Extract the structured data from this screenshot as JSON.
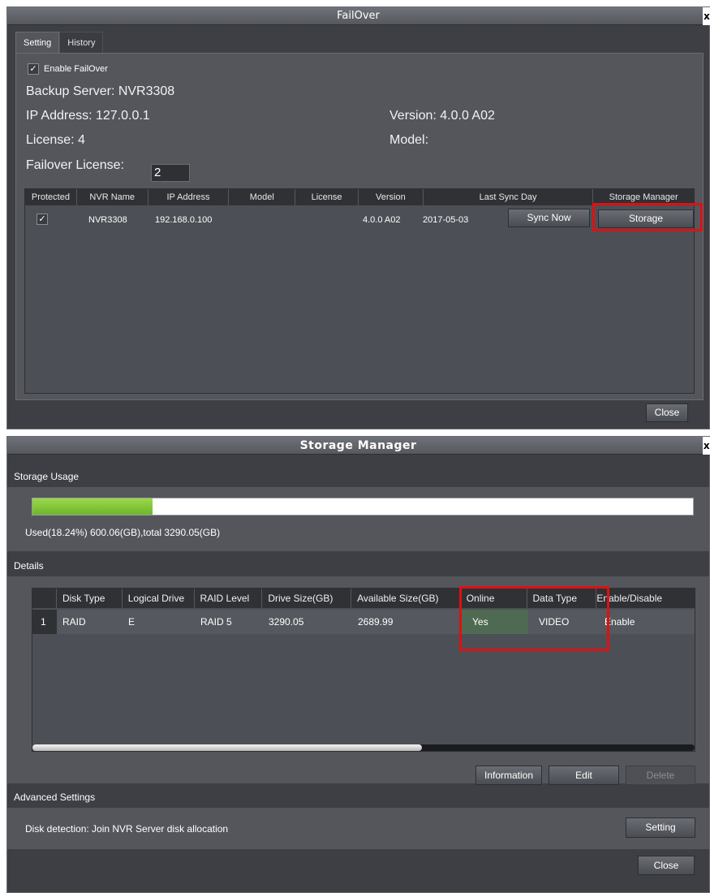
{
  "failover": {
    "title": "FailOver",
    "close_x": "x",
    "tabs": [
      "Setting",
      "History"
    ],
    "enable_label": "Enable FailOver",
    "enable_checked": "✓",
    "backup_server": "Backup Server: NVR3308",
    "ip_address": "IP Address: 127.0.0.1",
    "version": "Version: 4.0.0 A02",
    "license": "License: 4",
    "model": "Model:",
    "failover_license_label": "Failover License:",
    "failover_license_value": "2",
    "table": {
      "headers": [
        "Protected",
        "NVR Name",
        "IP Address",
        "Model",
        "License",
        "Version",
        "Last Sync Day",
        "Storage Manager"
      ],
      "row": {
        "protected": "✓",
        "nvr_name": "NVR3308",
        "ip": "192.168.0.100",
        "model": "",
        "license": "",
        "version": "4.0.0 A02",
        "last_sync": "2017-05-03",
        "sync_button": "Sync Now",
        "storage_button": "Storage"
      }
    },
    "close_button": "Close"
  },
  "storage_manager": {
    "title": "Storage Manager",
    "close_x": "x",
    "usage_label": "Storage Usage",
    "used_percent": 18.24,
    "usage_text": "Used(18.24%) 600.06(GB),total 3290.05(GB)",
    "details_label": "Details",
    "table": {
      "headers": [
        "",
        "Disk Type",
        "Logical Drive",
        "RAID Level",
        "Drive Size(GB)",
        "Available Size(GB)",
        "Online",
        "Data Type",
        "Enable/Disable"
      ],
      "row": [
        "1",
        "RAID",
        "E",
        "RAID 5",
        "3290.05",
        "2689.99",
        "Yes",
        "VIDEO",
        "Enable"
      ]
    },
    "buttons": {
      "information": "Information",
      "edit": "Edit",
      "delete": "Delete"
    },
    "advanced_label": "Advanced Settings",
    "disk_detection": "Disk detection: Join NVR Server disk allocation",
    "setting_button": "Setting",
    "close_button": "Close"
  },
  "colors": {
    "highlight": "#e01010",
    "usage_fill": "#8bc93e"
  }
}
